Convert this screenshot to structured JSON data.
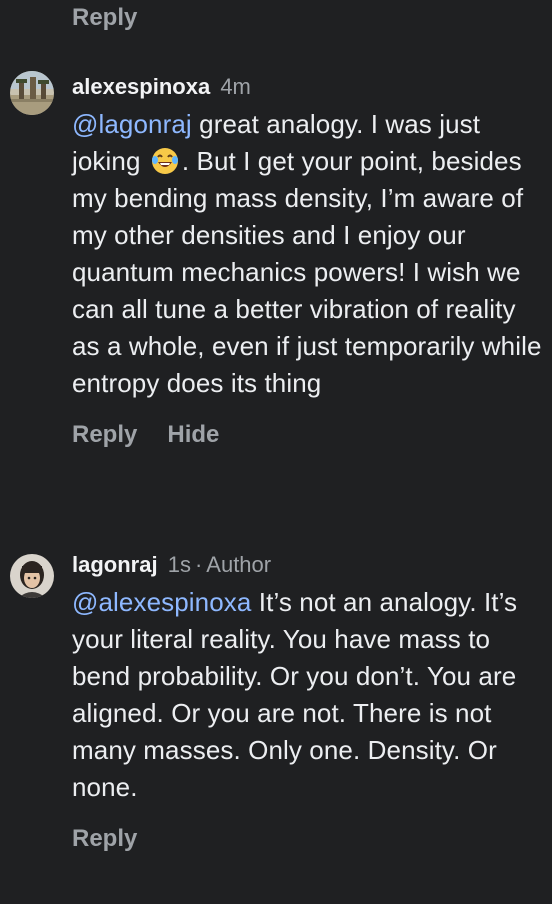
{
  "top": {
    "reply_label": "Reply"
  },
  "comments": [
    {
      "username": "alexespinoxa",
      "time": "4m",
      "mention": "@lagonraj",
      "text_before_emoji": " great analogy. I was just joking ",
      "emoji": "face-with-tears-of-joy",
      "text_after_emoji": ". But I get your point, besides my bending mass density, I’m aware of my other densities and I enjoy our quantum mechanics powers! I wish we can all tune a better vibration of reality as a whole, even if just temporarily while entropy does its thing",
      "actions": {
        "reply": "Reply",
        "hide": "Hide"
      }
    },
    {
      "username": "lagonraj",
      "time": "1s",
      "separator": "·",
      "badge": "Author",
      "mention": "@alexespinoxa",
      "text": " It’s not an analogy. It’s your literal reality. You have mass to bend probability. Or you don’t. You are aligned. Or you are not. There is not many masses. Only one. Density. Or none.",
      "actions": {
        "reply": "Reply"
      }
    }
  ],
  "colors": {
    "background": "#1f2022",
    "mention": "#8eb8ff",
    "secondary_text": "#9fa3a8",
    "primary_text": "#eceef1"
  }
}
